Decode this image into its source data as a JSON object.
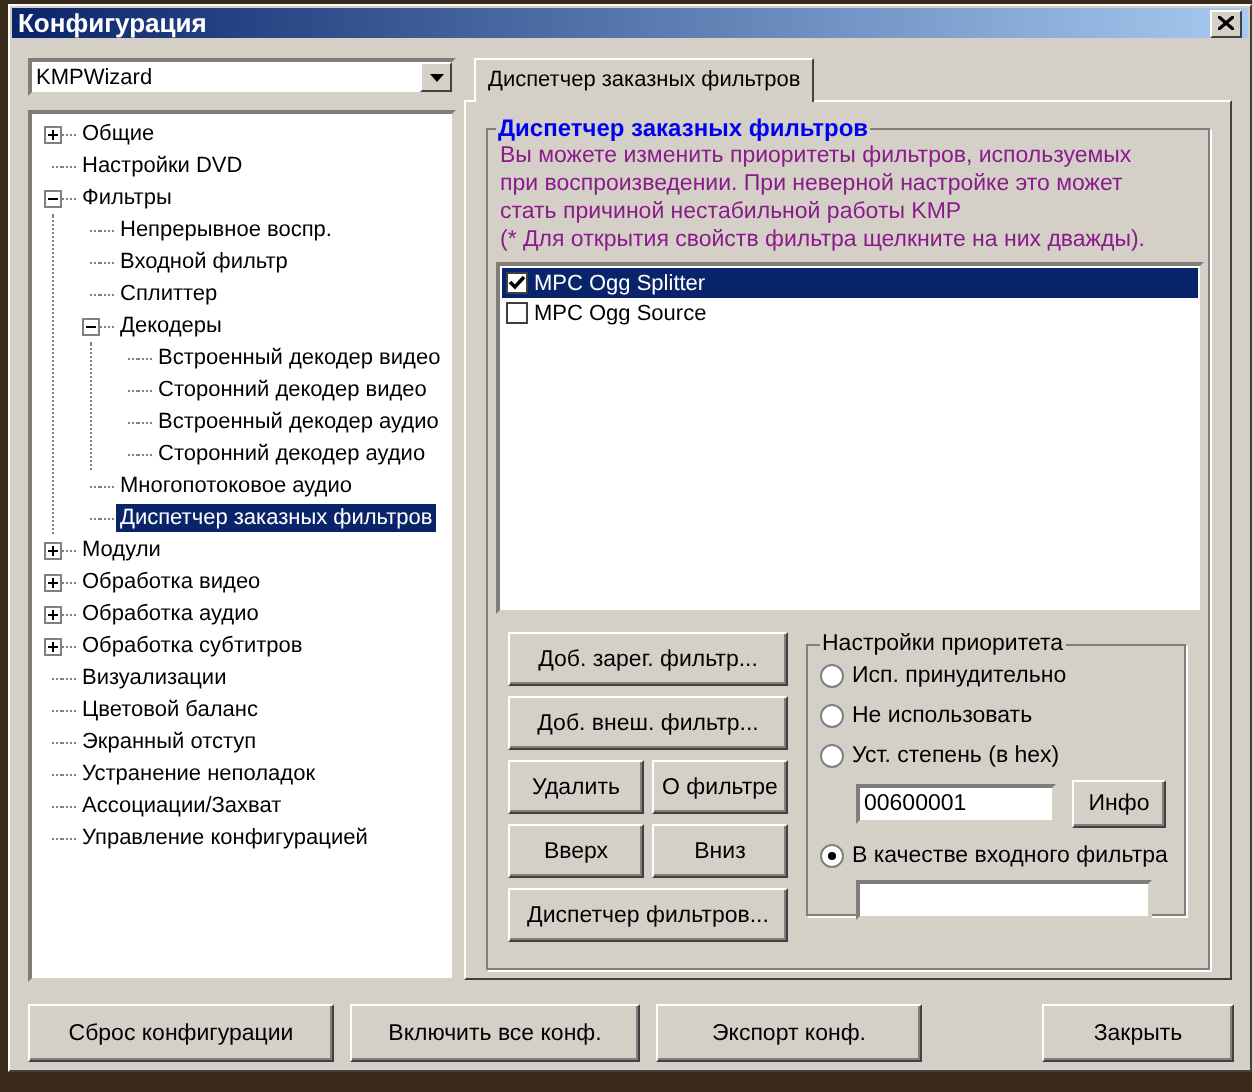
{
  "window": {
    "title": "Конфигурация"
  },
  "profile_select": {
    "value": "KMPWizard"
  },
  "tree": {
    "items": [
      {
        "label": "Общие",
        "expanded": false,
        "selected": false
      },
      {
        "label": "Настройки DVD",
        "selected": false
      },
      {
        "label": "Фильтры",
        "expanded": true,
        "selected": false,
        "children": [
          {
            "label": "Непрерывное воспр.",
            "selected": false
          },
          {
            "label": "Входной фильтр",
            "selected": false
          },
          {
            "label": "Сплиттер",
            "selected": false
          },
          {
            "label": "Декодеры",
            "expanded": true,
            "selected": false,
            "children": [
              {
                "label": "Встроенный декодер видео",
                "selected": false
              },
              {
                "label": "Сторонний декодер видео",
                "selected": false
              },
              {
                "label": "Встроенный декодер аудио",
                "selected": false
              },
              {
                "label": "Сторонний декодер аудио",
                "selected": false
              }
            ]
          },
          {
            "label": "Многопотоковое аудио",
            "selected": false
          },
          {
            "label": "Диспетчер заказных фильтров",
            "selected": true
          }
        ]
      },
      {
        "label": "Модули",
        "expanded": false,
        "selected": false
      },
      {
        "label": "Обработка видео",
        "expanded": false,
        "selected": false
      },
      {
        "label": "Обработка аудио",
        "expanded": false,
        "selected": false
      },
      {
        "label": "Обработка субтитров",
        "expanded": false,
        "selected": false
      },
      {
        "label": "Визуализации",
        "selected": false
      },
      {
        "label": "Цветовой баланс",
        "selected": false
      },
      {
        "label": "Экранный отступ",
        "selected": false
      },
      {
        "label": "Устранение неполадок",
        "selected": false
      },
      {
        "label": "Ассоциации/Захват",
        "selected": false
      },
      {
        "label": "Управление конфигурацией",
        "selected": false
      }
    ]
  },
  "tabs": [
    {
      "label": "Диспетчер заказных фильтров",
      "selected": true
    }
  ],
  "filter_group": {
    "title": "Диспетчер заказных фильтров",
    "description": "Вы можете изменить приоритеты фильтров, используемых при воспроизведении. При неверной настройке это может стать причиной нестабильной работы KMP",
    "note": "(* Для открытия свойств фильтра щелкните на них дважды).",
    "filters": [
      {
        "name": "MPC Ogg Splitter",
        "checked": true,
        "selected": true
      },
      {
        "name": "MPC Ogg Source",
        "checked": false,
        "selected": false
      }
    ],
    "action_buttons": [
      [
        "Доб. зарег. фильтр..."
      ],
      [
        "Доб. внеш. фильтр..."
      ],
      [
        "Удалить",
        "О фильтре"
      ],
      [
        "Вверх",
        "Вниз"
      ],
      [
        "Диспетчер фильтров..."
      ]
    ],
    "priority": {
      "title": "Настройки приоритета",
      "options": [
        {
          "label": "Исп. принудительно",
          "selected": false,
          "kind": "plain"
        },
        {
          "label": "Не использовать",
          "selected": false,
          "kind": "plain"
        },
        {
          "label": "Уст. степень (в hex)",
          "selected": false,
          "kind": "value_field",
          "value": "00600001",
          "button": "Инфо"
        },
        {
          "label": "В качестве входного фильтра",
          "selected": true,
          "kind": "empty_field"
        }
      ]
    }
  },
  "footer_buttons": [
    "Сброс конфигурации",
    "Включить все конф.",
    "Экспорт конф."
  ],
  "close_button": "Закрыть"
}
